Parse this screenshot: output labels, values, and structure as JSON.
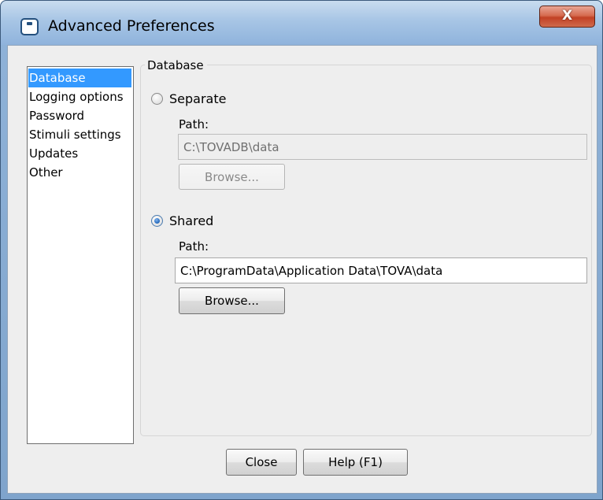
{
  "window": {
    "title": "Advanced Preferences",
    "close_glyph": "X"
  },
  "sidebar": {
    "items": [
      {
        "label": "Database",
        "selected": true
      },
      {
        "label": "Logging options"
      },
      {
        "label": "Password"
      },
      {
        "label": "Stimuli settings"
      },
      {
        "label": "Updates"
      },
      {
        "label": "Other"
      }
    ]
  },
  "database": {
    "group_title": "Database",
    "separate": {
      "label": "Separate",
      "checked": false,
      "path_label": "Path:",
      "path_value": "C:\\TOVADB\\data",
      "browse_label": "Browse...",
      "enabled": false
    },
    "shared": {
      "label": "Shared",
      "checked": true,
      "path_label": "Path:",
      "path_value": "C:\\ProgramData\\Application Data\\TOVA\\data",
      "browse_label": "Browse...",
      "enabled": true
    }
  },
  "footer": {
    "close_label": "Close",
    "help_label": "Help (F1)"
  },
  "colors": {
    "selection": "#3399ff",
    "titlebar": "#a7c5e5",
    "close_button": "#c24125",
    "dialog_bg": "#eeeeee"
  }
}
